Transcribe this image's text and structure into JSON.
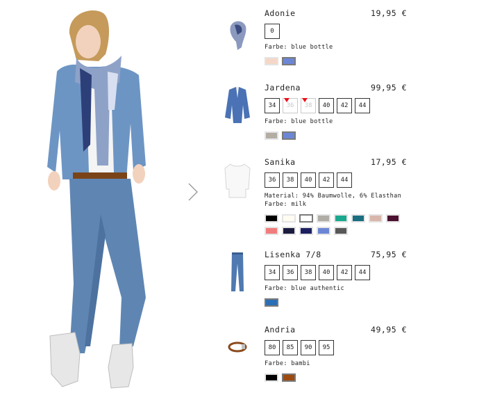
{
  "products": [
    {
      "name": "Adonie",
      "price": "19,95 €",
      "sizes": [
        {
          "label": "0"
        }
      ],
      "info": [
        "Farbe: blue bottle"
      ],
      "swatch_rows": [
        [
          {
            "color": "#f5d7c8"
          },
          {
            "color": "#6c86d6",
            "selected": true
          }
        ]
      ],
      "thumb_icon": "scarf-icon"
    },
    {
      "name": "Jardena",
      "price": "99,95 €",
      "sizes": [
        {
          "label": "34"
        },
        {
          "label": "36",
          "disabled": true
        },
        {
          "label": "38",
          "disabled": true
        },
        {
          "label": "40"
        },
        {
          "label": "42"
        },
        {
          "label": "44"
        }
      ],
      "info": [
        "Farbe: blue bottle"
      ],
      "swatch_rows": [
        [
          {
            "color": "#b3ada3"
          },
          {
            "color": "#6c86d6",
            "selected": true
          }
        ]
      ],
      "thumb_icon": "blazer-icon"
    },
    {
      "name": "Sanika",
      "price": "17,95 €",
      "sizes": [
        {
          "label": "36"
        },
        {
          "label": "38"
        },
        {
          "label": "40"
        },
        {
          "label": "42"
        },
        {
          "label": "44"
        }
      ],
      "info": [
        "Material: 94% Baumwolle, 6% Elasthan",
        "Farbe: milk"
      ],
      "swatch_rows": [
        [
          {
            "color": "#000000"
          },
          {
            "color": "#fffcf2"
          },
          {
            "color": "#ffffff",
            "selected": true
          },
          {
            "color": "#b0aca6"
          },
          {
            "color": "#1aa88e"
          },
          {
            "color": "#1a6e80"
          },
          {
            "color": "#d9b6ab"
          },
          {
            "color": "#4c1030"
          }
        ],
        [
          {
            "color": "#f07c7c"
          },
          {
            "color": "#1b1b40"
          },
          {
            "color": "#1c2060"
          },
          {
            "color": "#6c86d6"
          },
          {
            "color": "#585858"
          }
        ]
      ],
      "thumb_icon": "tshirt-icon"
    },
    {
      "name": "Lisenka 7/8",
      "price": "75,95 €",
      "sizes": [
        {
          "label": "34"
        },
        {
          "label": "36"
        },
        {
          "label": "38"
        },
        {
          "label": "40"
        },
        {
          "label": "42"
        },
        {
          "label": "44"
        }
      ],
      "info": [
        "Farbe: blue authentic"
      ],
      "swatch_rows": [
        [
          {
            "color": "#2a6fb5",
            "selected": true
          }
        ]
      ],
      "thumb_icon": "jeans-icon"
    },
    {
      "name": "Andria",
      "price": "49,95 €",
      "sizes": [
        {
          "label": "80"
        },
        {
          "label": "85"
        },
        {
          "label": "90"
        },
        {
          "label": "95"
        }
      ],
      "info": [
        "Farbe: bambi"
      ],
      "swatch_rows": [
        [
          {
            "color": "#000000"
          },
          {
            "color": "#9c4a10",
            "selected": true
          }
        ]
      ],
      "thumb_icon": "belt-icon"
    }
  ]
}
